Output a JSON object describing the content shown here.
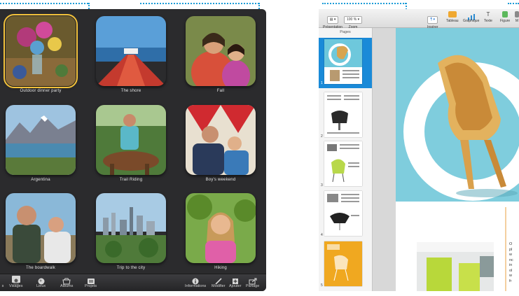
{
  "iphoto": {
    "events": [
      {
        "label": "Outdoor dinner party",
        "selected": true
      },
      {
        "label": "The shore",
        "selected": false
      },
      {
        "label": "Fall",
        "selected": false
      },
      {
        "label": "Argentina",
        "selected": false
      },
      {
        "label": "Trail Riding",
        "selected": false
      },
      {
        "label": "Boy's weekend",
        "selected": false
      },
      {
        "label": "The boardwalk",
        "selected": false
      },
      {
        "label": "Trip to the city",
        "selected": false
      },
      {
        "label": "Hiking",
        "selected": false
      }
    ],
    "toolbar": {
      "left": [
        {
          "label": "s",
          "icon": "grid-icon"
        },
        {
          "label": "Visages",
          "icon": "faces-icon"
        },
        {
          "label": "Lieux",
          "icon": "places-icon"
        },
        {
          "label": "Albums",
          "icon": "albums-icon"
        },
        {
          "label": "Projets",
          "icon": "projects-icon"
        }
      ],
      "right": [
        {
          "label": "Informations",
          "icon": "info-icon"
        },
        {
          "label": "Modifier",
          "icon": "edit-icon"
        },
        {
          "label": "Ajouter",
          "icon": "add-icon"
        },
        {
          "label": "Partage",
          "icon": "share-icon"
        }
      ]
    }
  },
  "pages": {
    "toolbar": {
      "presentation_label": "Présentation",
      "zoom_value": "100 %",
      "zoom_label": "Zoom",
      "insert_label": "Insérer",
      "table_label": "Tableau",
      "chart_label": "Graphique",
      "text_label": "Texte",
      "shape_label": "Figure",
      "media_label": "M"
    },
    "sidebar_title": "Pages",
    "page_numbers": [
      "1",
      "2",
      "3",
      "4",
      "5"
    ],
    "doc_text_fragments": [
      "O",
      "pl",
      "w",
      "nc",
      "in",
      "ol",
      "w",
      "fr"
    ]
  }
}
